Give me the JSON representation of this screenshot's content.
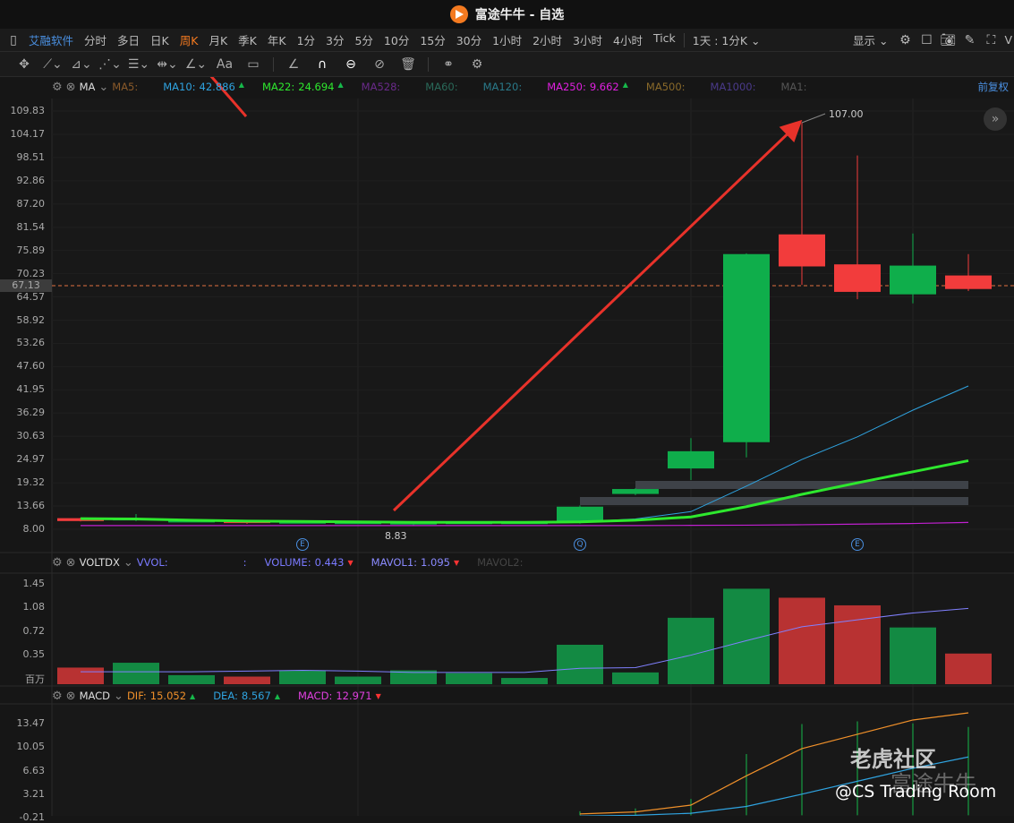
{
  "title": "富途牛牛 - 自选",
  "toolbar": {
    "brand": "艾融软件",
    "periods": [
      "分时",
      "多日",
      "日K",
      "周K",
      "月K",
      "季K",
      "年K",
      "1分",
      "3分",
      "5分",
      "10分",
      "15分",
      "30分",
      "1小时",
      "2小时",
      "3小时",
      "4小时",
      "Tick"
    ],
    "active": "周K",
    "range": "1天 : 1分K",
    "display": "显示",
    "cut": "V"
  },
  "ma_legend": {
    "name": "MA",
    "items": [
      {
        "label": "MA5:",
        "value": "",
        "color": "#8a5a2a"
      },
      {
        "label": "MA10:",
        "value": "42.886",
        "color": "#2fa3e0",
        "trend": "up"
      },
      {
        "label": "MA22:",
        "value": "24.694",
        "color": "#2ee82e",
        "trend": "up"
      },
      {
        "label": "MA528:",
        "value": "",
        "color": "#6a2a8a"
      },
      {
        "label": "MA60:",
        "value": "",
        "color": "#2a6a5a"
      },
      {
        "label": "MA120:",
        "value": "",
        "color": "#2a7a8a"
      },
      {
        "label": "MA250:",
        "value": "9.662",
        "color": "#e020e0",
        "trend": "up"
      },
      {
        "label": "MA500:",
        "value": "",
        "color": "#8a6a2a"
      },
      {
        "label": "MA1000:",
        "value": "",
        "color": "#4a3a8a"
      },
      {
        "label": "MA1:",
        "value": "",
        "color": "#555"
      }
    ],
    "adjust": "前复权"
  },
  "vol_legend": {
    "name": "VOLTDX",
    "vvol": "VVOL:",
    "colon": ":",
    "volume_label": "VOLUME:",
    "volume": "0.443",
    "mavol1_label": "MAVOL1:",
    "mavol1": "1.095",
    "mavol2_label": "MAVOL2:"
  },
  "macd_legend": {
    "name": "MACD",
    "dif_label": "DIF:",
    "dif": "15.052",
    "dea_label": "DEA:",
    "dea": "8.567",
    "macd_label": "MACD:",
    "macd": "12.971"
  },
  "price_axis": [
    "109.83",
    "104.17",
    "98.51",
    "92.86",
    "87.20",
    "81.54",
    "75.89",
    "70.23",
    "64.57",
    "58.92",
    "53.26",
    "47.60",
    "41.95",
    "36.29",
    "30.63",
    "24.97",
    "19.32",
    "13.66",
    "8.00"
  ],
  "last_price": "67.13",
  "vol_axis": [
    "1.45",
    "1.08",
    "0.72",
    "0.35",
    "百万"
  ],
  "macd_axis": [
    "13.47",
    "10.05",
    "6.63",
    "3.21",
    "-0.21"
  ],
  "annotations": {
    "high": "107.00",
    "low": "8.83",
    "event_marks": [
      "E",
      "Q",
      "E"
    ]
  },
  "watermark": {
    "community": "老虎社区",
    "brand": "富途牛牛",
    "credit": "@CS Trading Room"
  },
  "colors": {
    "up": "#f23c3c",
    "down": "#0fae4b",
    "bg": "#161616"
  },
  "chart_data": {
    "type": "candlestick",
    "ylim": [
      8.0,
      109.83
    ],
    "candles": [
      {
        "o": 10.0,
        "h": 10.8,
        "l": 9.9,
        "c": 10.7,
        "color": "red"
      },
      {
        "o": 10.6,
        "h": 11.7,
        "l": 10.0,
        "c": 10.2,
        "color": "green"
      },
      {
        "o": 10.1,
        "h": 10.4,
        "l": 9.8,
        "c": 9.9,
        "color": "green"
      },
      {
        "o": 9.5,
        "h": 10.1,
        "l": 9.3,
        "c": 10.0,
        "color": "red"
      },
      {
        "o": 9.8,
        "h": 9.9,
        "l": 9.4,
        "c": 9.5,
        "color": "green"
      },
      {
        "o": 9.7,
        "h": 9.8,
        "l": 9.3,
        "c": 9.5,
        "color": "green"
      },
      {
        "o": 9.6,
        "h": 9.8,
        "l": 8.83,
        "c": 9.5,
        "color": "green"
      },
      {
        "o": 9.7,
        "h": 9.8,
        "l": 9.4,
        "c": 9.5,
        "color": "green"
      },
      {
        "o": 9.7,
        "h": 9.8,
        "l": 9.4,
        "c": 9.5,
        "color": "green"
      },
      {
        "o": 13.5,
        "h": 13.8,
        "l": 9.4,
        "c": 9.8,
        "color": "green"
      },
      {
        "o": 17.8,
        "h": 18.0,
        "l": 16.3,
        "c": 16.6,
        "color": "green"
      },
      {
        "o": 27.0,
        "h": 30.2,
        "l": 20.0,
        "c": 22.8,
        "color": "green"
      },
      {
        "o": 75.0,
        "h": 75.2,
        "l": 25.5,
        "c": 29.2,
        "color": "green"
      },
      {
        "o": 72.0,
        "h": 107.0,
        "l": 67.5,
        "c": 79.8,
        "color": "red"
      },
      {
        "o": 65.8,
        "h": 99.0,
        "l": 64.0,
        "c": 72.5,
        "color": "red"
      },
      {
        "o": 72.2,
        "h": 80.0,
        "l": 63.0,
        "c": 65.2,
        "color": "green"
      },
      {
        "o": 66.5,
        "h": 75.0,
        "l": 66.0,
        "c": 69.8,
        "color": "red"
      }
    ],
    "ma10": [
      null,
      null,
      null,
      null,
      null,
      null,
      null,
      null,
      null,
      9.8,
      10.5,
      12.3,
      18.5,
      25.0,
      30.5,
      37.0,
      42.886
    ],
    "ma22": [
      10.6,
      10.5,
      10.2,
      10.0,
      9.9,
      9.8,
      9.7,
      9.7,
      9.7,
      9.8,
      10.2,
      11.0,
      13.5,
      16.5,
      19.3,
      22.0,
      24.694
    ],
    "ma250": [
      8.9,
      8.9,
      8.9,
      8.9,
      8.9,
      8.9,
      8.9,
      8.9,
      8.9,
      8.9,
      8.9,
      8.95,
      9.0,
      9.1,
      9.25,
      9.4,
      9.662
    ],
    "volume": {
      "ylim": [
        0,
        1.45
      ],
      "unit": "百万",
      "values": [
        0.24,
        0.31,
        0.13,
        0.11,
        0.2,
        0.11,
        0.2,
        0.16,
        0.09,
        0.57,
        0.17,
        0.96,
        1.38,
        1.25,
        1.14,
        0.82,
        0.443
      ],
      "mavol1": [
        0.18,
        0.18,
        0.18,
        0.19,
        0.2,
        0.19,
        0.17,
        0.17,
        0.17,
        0.23,
        0.24,
        0.42,
        0.63,
        0.83,
        0.93,
        1.03,
        1.095
      ]
    },
    "macd": {
      "ylim": [
        -0.21,
        13.47
      ],
      "dif": [
        null,
        null,
        null,
        null,
        null,
        null,
        null,
        null,
        null,
        0.2,
        0.5,
        1.5,
        5.8,
        9.8,
        11.9,
        14.0,
        15.052
      ],
      "dea": [
        null,
        null,
        null,
        null,
        null,
        null,
        null,
        null,
        null,
        -0.1,
        0.0,
        0.3,
        1.3,
        3.1,
        5.0,
        6.9,
        8.567
      ],
      "hist": [
        0,
        0,
        0,
        0,
        0,
        0,
        0,
        0,
        0,
        0.6,
        1.0,
        2.4,
        9.0,
        13.4,
        13.8,
        13.5,
        12.971
      ]
    }
  }
}
